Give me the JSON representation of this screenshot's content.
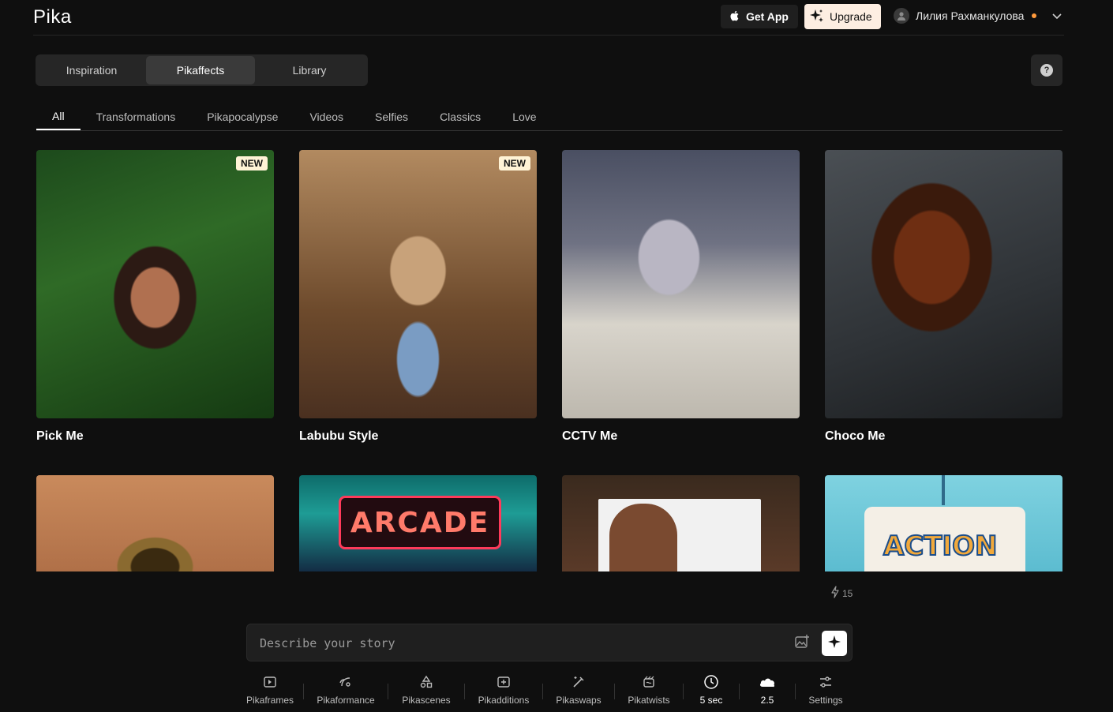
{
  "header": {
    "logo": "Pika",
    "get_app_label": "Get App",
    "upgrade_label": "Upgrade",
    "user_name": "Лилия Рахманкулова"
  },
  "mode_tabs": [
    {
      "label": "Inspiration",
      "active": false
    },
    {
      "label": "Pikaffects",
      "active": true
    },
    {
      "label": "Library",
      "active": false
    }
  ],
  "help_label": "?",
  "category_tabs": [
    {
      "label": "All",
      "active": true
    },
    {
      "label": "Transformations",
      "active": false
    },
    {
      "label": "Pikapocalypse",
      "active": false
    },
    {
      "label": "Videos",
      "active": false
    },
    {
      "label": "Selfies",
      "active": false
    },
    {
      "label": "Classics",
      "active": false
    },
    {
      "label": "Love",
      "active": false
    }
  ],
  "cards": [
    {
      "title": "Pick Me",
      "badge": "NEW"
    },
    {
      "title": "Labubu Style",
      "badge": "NEW"
    },
    {
      "title": "CCTV Me",
      "badge": ""
    },
    {
      "title": "Choco Me",
      "badge": ""
    }
  ],
  "second_row": {
    "arcade_text": "ARCADE",
    "action_text": "ACTION"
  },
  "credits": "15",
  "prompt": {
    "placeholder": "Describe your story"
  },
  "toolbar": [
    {
      "label": "Pikaframes",
      "icon": "frames-icon"
    },
    {
      "label": "Pikaformance",
      "icon": "performance-icon"
    },
    {
      "label": "Pikascenes",
      "icon": "shapes-icon"
    },
    {
      "label": "Pikadditions",
      "icon": "additions-icon"
    },
    {
      "label": "Pikaswaps",
      "icon": "swap-wand-icon"
    },
    {
      "label": "Pikatwists",
      "icon": "twist-icon"
    },
    {
      "label": "5 sec",
      "icon": "clock-icon"
    },
    {
      "label": "2.5",
      "icon": "cloud-icon"
    },
    {
      "label": "Settings",
      "icon": "sliders-icon"
    }
  ],
  "colors": {
    "background": "#0f0f0f",
    "upgrade_bg": "#fdeee2",
    "badge_bg": "#fff3d6",
    "status_dot": "#ff9a3c"
  }
}
